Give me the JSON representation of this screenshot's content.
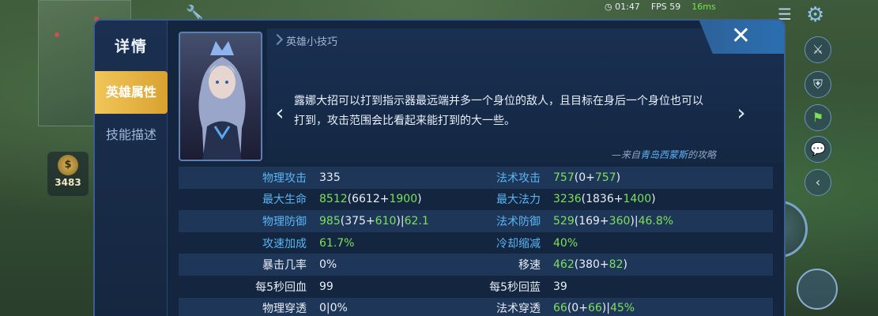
{
  "hud": {
    "gold": "3483",
    "time": "01:47",
    "fps": "FPS 59",
    "ping": "16ms"
  },
  "panel": {
    "title": "详情",
    "tabs": [
      "英雄属性",
      "技能描述"
    ],
    "close_label": "✕"
  },
  "tip": {
    "title": "英雄小技巧",
    "text": "露娜大招可以打到指示器最远端并多一个身位的敌人，且目标在身后一个身位也可以打到，攻击范围会比看起来能打到的大一些。",
    "source_prefix": "—来自",
    "source_author": "青岛西蒙斯",
    "source_suffix": "的攻略",
    "prev_arrow": "‹",
    "next_arrow": "›"
  },
  "stats": [
    {
      "label": "物理攻击",
      "label_color": "blue",
      "value": "335",
      "bonus": "",
      "pct": "",
      "label2": "法术攻击",
      "label2_color": "blue",
      "value2": "757",
      "bonus2": "(0+757)",
      "pct2": ""
    },
    {
      "label": "最大生命",
      "label_color": "blue",
      "value": "8512",
      "bonus": "(6612+1900)",
      "pct": "",
      "label2": "最大法力",
      "label2_color": "blue",
      "value2": "3236",
      "bonus2": "(1836+1400)",
      "pct2": ""
    },
    {
      "label": "物理防御",
      "label_color": "blue",
      "value": "985",
      "bonus": "(375+610)",
      "pct": "62.1",
      "label2": "法术防御",
      "label2_color": "blue",
      "value2": "529",
      "bonus2": "(169+360)",
      "pct2": "46.8%"
    },
    {
      "label": "攻速加成",
      "label_color": "blue",
      "value": "61.7%",
      "bonus": "",
      "pct": "",
      "label2": "冷却缩减",
      "label2_color": "blue",
      "value2": "40%",
      "bonus2": "",
      "pct2": ""
    },
    {
      "label": "暴击几率",
      "label_color": "white",
      "value": "0%",
      "bonus": "",
      "pct": "",
      "label2": "移速",
      "label2_color": "white",
      "value2": "462",
      "bonus2": "(380+82)",
      "pct2": ""
    },
    {
      "label": "每5秒回血",
      "label_color": "white",
      "value": "99",
      "bonus": "",
      "pct": "",
      "label2": "每5秒回蓝",
      "label2_color": "white",
      "value2": "39",
      "bonus2": "",
      "pct2": ""
    },
    {
      "label": "物理穿透",
      "label_color": "white",
      "value": "0|0%",
      "bonus": "",
      "pct": "",
      "label2": "法术穿透",
      "label2_color": "white",
      "value2": "66",
      "bonus2": "(0+66)",
      "pct2": "45%"
    }
  ],
  "colors": {
    "panel_bg": "#13253f",
    "accent_gold": "#f1c65a",
    "label_blue": "#58b6f4",
    "value_green": "#7ee05a",
    "close_blue": "#2b6fb1"
  }
}
